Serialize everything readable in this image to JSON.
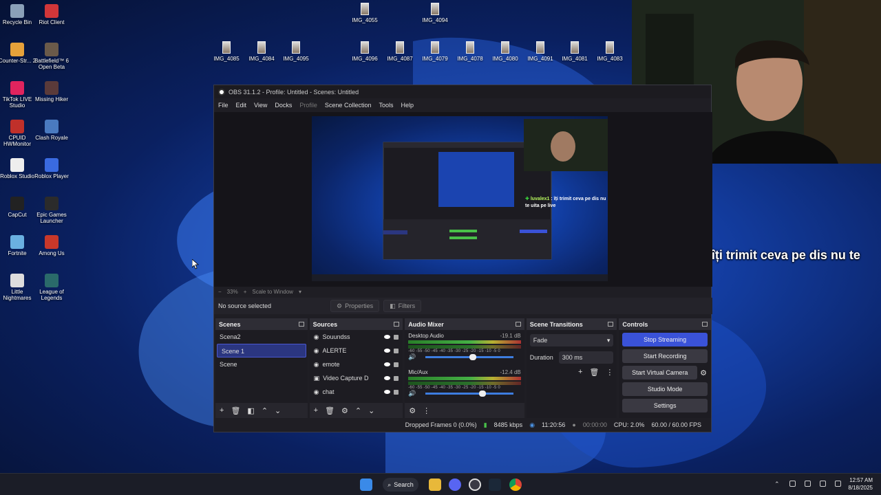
{
  "desktop": {
    "left_icons": [
      {
        "label": "Recycle Bin",
        "icon": "recycle-bin-icon",
        "color": "#8aa0b8"
      },
      {
        "label": "Riot Client",
        "icon": "riot-client-icon",
        "color": "#d13639"
      },
      {
        "label": "Counter-Str... 2",
        "icon": "counter-strike-icon",
        "color": "#e6a13a"
      },
      {
        "label": "Battlefield™ 6 Open Beta",
        "icon": "battlefield-icon",
        "color": "#6a5a4a"
      },
      {
        "label": "TikTok LIVE Studio",
        "icon": "tiktok-icon",
        "color": "#e0245e"
      },
      {
        "label": "Missing Hiker",
        "icon": "missing-hiker-icon",
        "color": "#5a3a3a"
      },
      {
        "label": "CPUID HWMonitor",
        "icon": "hwmonitor-icon",
        "color": "#c0302a"
      },
      {
        "label": "Clash Royale",
        "icon": "clash-royale-icon",
        "color": "#4a7ac0"
      },
      {
        "label": "Roblox Studio",
        "icon": "roblox-studio-icon",
        "color": "#eeeeee"
      },
      {
        "label": "Roblox Player",
        "icon": "roblox-player-icon",
        "color": "#3a6ae0"
      },
      {
        "label": "CapCut",
        "icon": "capcut-icon",
        "color": "#222222"
      },
      {
        "label": "Epic Games Launcher",
        "icon": "epic-games-icon",
        "color": "#2b2b2b"
      },
      {
        "label": "Fortnite",
        "icon": "fortnite-icon",
        "color": "#6ab0e0"
      },
      {
        "label": "Among Us",
        "icon": "among-us-icon",
        "color": "#c8382a"
      },
      {
        "label": "Little Nightmares",
        "icon": "little-nightmares-icon",
        "color": "#dddddd"
      },
      {
        "label": "League of Legends",
        "icon": "league-of-legends-icon",
        "color": "#2a6a6a"
      }
    ],
    "image_files": [
      "IMG_4055",
      "IMG_4094",
      "IMG_4085",
      "IMG_4084",
      "IMG_4095",
      "IMG_4096",
      "IMG_4087",
      "IMG_4079",
      "IMG_4078",
      "IMG_4080",
      "IMG_4091",
      "IMG_4081",
      "IMG_4083"
    ]
  },
  "chat": {
    "username": "luvalex1",
    "message": " : îți trimit ceva pe dis nu te uita pe live"
  },
  "obs": {
    "title": "OBS 31.1.2 - Profile: Untitled - Scenes: Untitled",
    "menu": [
      "File",
      "Edit",
      "View",
      "Docks",
      "Profile",
      "Scene Collection",
      "Tools",
      "Help"
    ],
    "zoom_percent": "33%",
    "zoom_mode": "Scale to Window",
    "no_source_text": "No source selected",
    "properties_label": "Properties",
    "filters_label": "Filters",
    "preview_chat_user": "luvalex1",
    "preview_chat_text": " : îți trimit ceva pe dis nu te uita pe live",
    "scenes": {
      "title": "Scenes",
      "items": [
        "Scena2",
        "Scene 1",
        "Scene"
      ],
      "selected": "Scene 1"
    },
    "sources": {
      "title": "Sources",
      "items": [
        "Souundss",
        "ALERTE",
        "emote",
        "Video Capture D",
        "chat"
      ]
    },
    "audio_mixer": {
      "title": "Audio Mixer",
      "channels": [
        {
          "name": "Desktop Audio",
          "db": "-19.1 dB",
          "level": 0.62,
          "volume": 0.72
        },
        {
          "name": "Mic/Aux",
          "db": "-12.4 dB",
          "level": 0.72,
          "volume": 0.82
        }
      ],
      "ticks": "-60 -55 -50 -45 -40 -35 -30 -25 -20 -15 -10 -5 0"
    },
    "transitions": {
      "title": "Scene Transitions",
      "selected": "Fade",
      "duration_label": "Duration",
      "duration_value": "300 ms"
    },
    "controls": {
      "title": "Controls",
      "stop_streaming": "Stop Streaming",
      "start_recording": "Start Recording",
      "start_virtual_camera": "Start Virtual Camera",
      "studio_mode": "Studio Mode",
      "settings": "Settings"
    },
    "status": {
      "dropped_frames": "Dropped Frames 0 (0.0%)",
      "bitrate": "8485 kbps",
      "stream_time": "11:20:56",
      "record_time": "00:00:00",
      "cpu": "CPU: 2.0%",
      "fps": "60.00 / 60.00 FPS"
    }
  },
  "taskbar": {
    "search_label": "Search",
    "time": "12:57 AM",
    "date": "8/18/2025"
  },
  "colors": {
    "accent": "#3a52d8",
    "selected_scene": "#2b3680",
    "chat_username": "#b7f75d"
  }
}
